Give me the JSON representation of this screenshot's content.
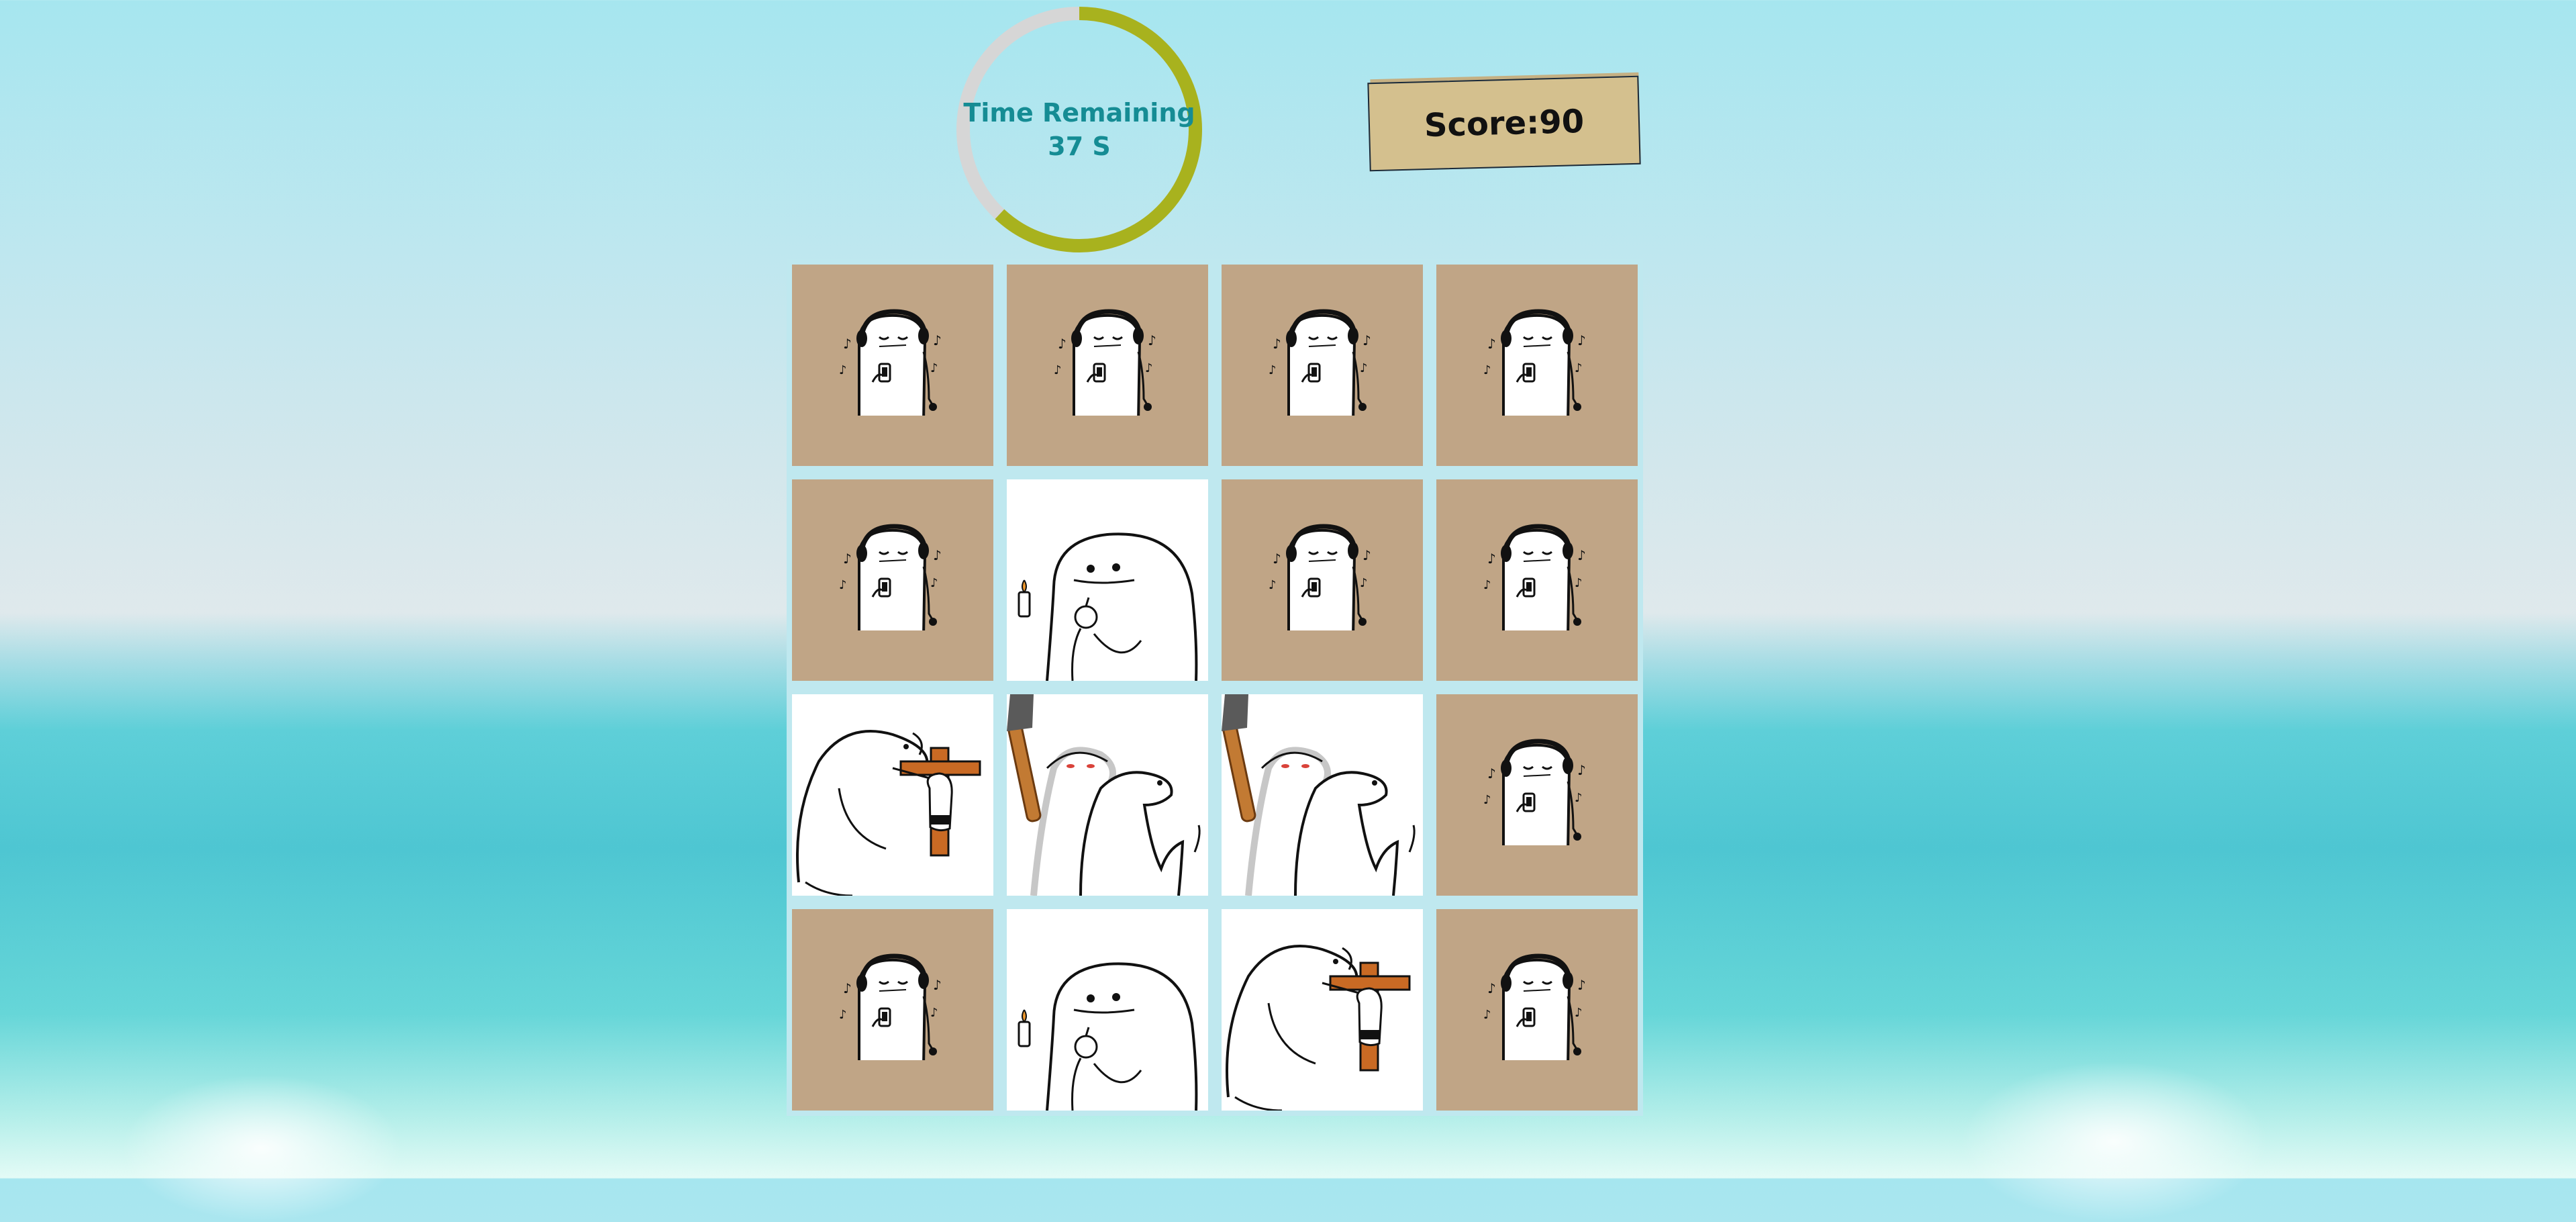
{
  "timer": {
    "label": "Time Remaining",
    "value": "37 S",
    "fraction_remaining": 0.62,
    "colors": {
      "progress": "#a8b21e",
      "track": "#d6d6d6",
      "text": "#158c94"
    }
  },
  "score": {
    "text": "Score:90",
    "value": 90
  },
  "board": {
    "rows": 4,
    "cols": 4,
    "cards": [
      {
        "state": "face-down",
        "icon": "music-listener-icon"
      },
      {
        "state": "face-down",
        "icon": "music-listener-icon"
      },
      {
        "state": "face-down",
        "icon": "music-listener-icon"
      },
      {
        "state": "face-down",
        "icon": "music-listener-icon"
      },
      {
        "state": "face-down",
        "icon": "music-listener-icon"
      },
      {
        "state": "face-up",
        "icon": "blob-holding-candle-and-bomb-icon"
      },
      {
        "state": "face-down",
        "icon": "music-listener-icon"
      },
      {
        "state": "face-down",
        "icon": "music-listener-icon"
      },
      {
        "state": "face-up",
        "icon": "blob-with-crucifix-icon"
      },
      {
        "state": "face-up",
        "icon": "blob-with-axe-icon"
      },
      {
        "state": "face-up",
        "icon": "blob-with-axe-icon"
      },
      {
        "state": "face-down",
        "icon": "music-listener-icon"
      },
      {
        "state": "face-down",
        "icon": "music-listener-icon"
      },
      {
        "state": "face-up",
        "icon": "blob-holding-candle-and-bomb-icon"
      },
      {
        "state": "face-up",
        "icon": "blob-with-crucifix-icon"
      },
      {
        "state": "face-down",
        "icon": "music-listener-icon"
      }
    ],
    "colors": {
      "card_back": "#c0a586",
      "card_face": "#ffffff",
      "board_bg": "#bfe8ef"
    }
  }
}
